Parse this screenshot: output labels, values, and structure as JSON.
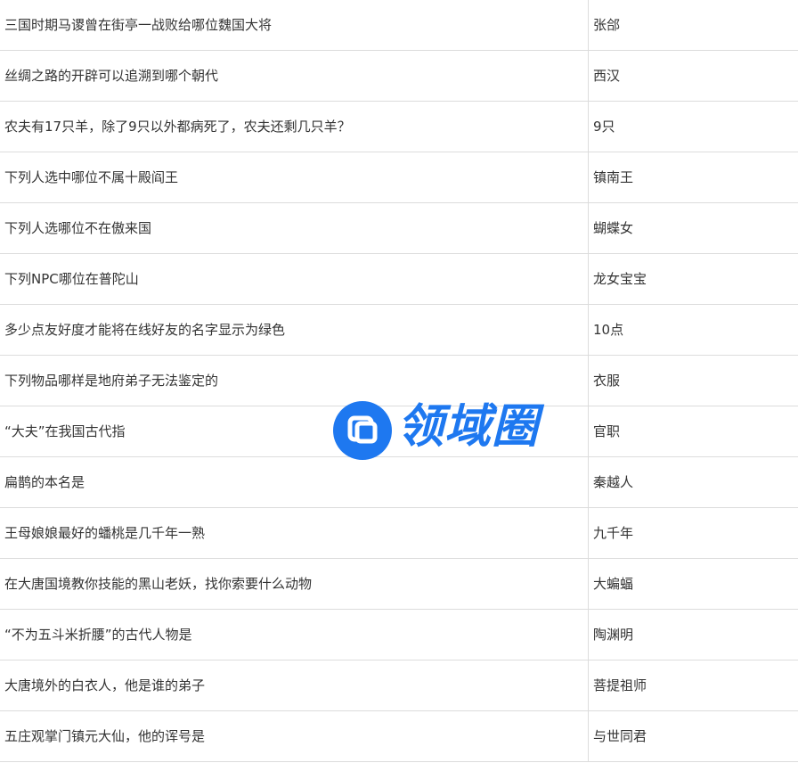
{
  "rows": [
    {
      "question": "三国时期马谡曾在街亭一战败给哪位魏国大将",
      "answer": "张郃"
    },
    {
      "question": "丝绸之路的开辟可以追溯到哪个朝代",
      "answer": "西汉"
    },
    {
      "question": "农夫有17只羊，除了9只以外都病死了，农夫还剩几只羊？",
      "answer": "9只"
    },
    {
      "question": "下列人选中哪位不属十殿阎王",
      "answer": "镇南王"
    },
    {
      "question": "下列人选哪位不在傲来国",
      "answer": "蝴蝶女"
    },
    {
      "question": "下列NPC哪位在普陀山",
      "answer": "龙女宝宝"
    },
    {
      "question": "多少点友好度才能将在线好友的名字显示为绿色",
      "answer": "10点"
    },
    {
      "question": "下列物品哪样是地府弟子无法鉴定的",
      "answer": "衣服"
    },
    {
      "question": "“大夫”在我国古代指",
      "answer": "官职"
    },
    {
      "question": "扁鹊的本名是",
      "answer": "秦越人"
    },
    {
      "question": "王母娘娘最好的蟠桃是几千年一熟",
      "answer": "九千年"
    },
    {
      "question": "在大唐国境教你技能的黑山老妖，找你索要什么动物",
      "answer": "大蝙蝠"
    },
    {
      "question": "“不为五斗米折腰”的古代人物是",
      "answer": "陶渊明"
    },
    {
      "question": "大唐境外的白衣人，他是谁的弟子",
      "answer": "菩提祖师"
    },
    {
      "question": "五庄观掌门镇元大仙，他的诨号是",
      "answer": "与世同君"
    }
  ],
  "watermark": {
    "text": "领域圈",
    "icon": "logo-icon",
    "color": "#1e78f0"
  }
}
